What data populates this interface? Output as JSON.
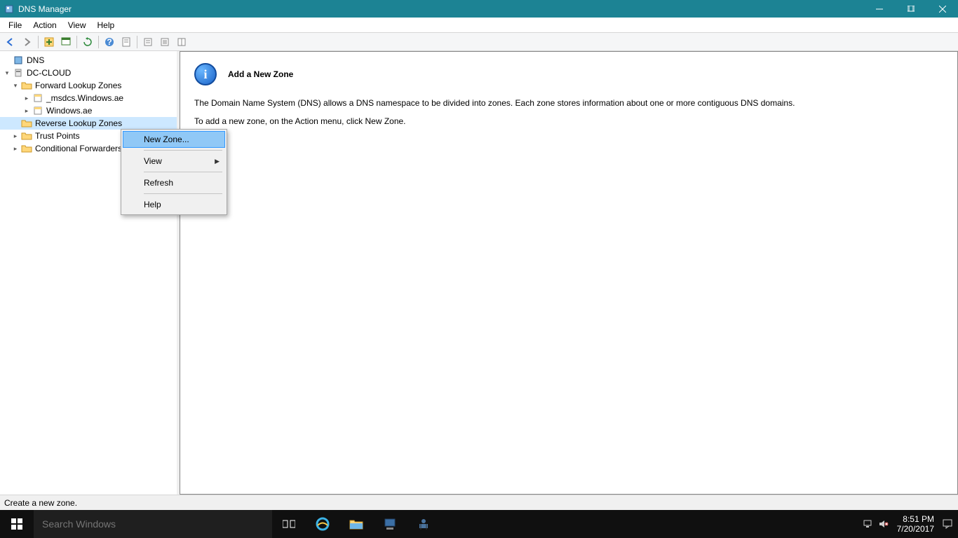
{
  "window": {
    "title": "DNS Manager"
  },
  "menubar": {
    "items": [
      "File",
      "Action",
      "View",
      "Help"
    ]
  },
  "tree": {
    "root": "DNS",
    "server": "DC-CLOUD",
    "flz": "Forward Lookup Zones",
    "flz_children": [
      "_msdcs.Windows.ae",
      "Windows.ae"
    ],
    "rlz": "Reverse Lookup Zones",
    "tp": "Trust Points",
    "cf": "Conditional Forwarders"
  },
  "content": {
    "title": "Add a New Zone",
    "p1": "The Domain Name System (DNS) allows a DNS namespace to be divided into zones. Each zone stores information about one or more contiguous DNS domains.",
    "p2": "To add a new zone, on the Action menu, click New Zone."
  },
  "context_menu": {
    "new_zone": "New Zone...",
    "view": "View",
    "refresh": "Refresh",
    "help": "Help"
  },
  "status": {
    "text": "Create a new zone."
  },
  "taskbar": {
    "search_placeholder": "Search Windows",
    "time": "8:51 PM",
    "date": "7/20/2017"
  }
}
